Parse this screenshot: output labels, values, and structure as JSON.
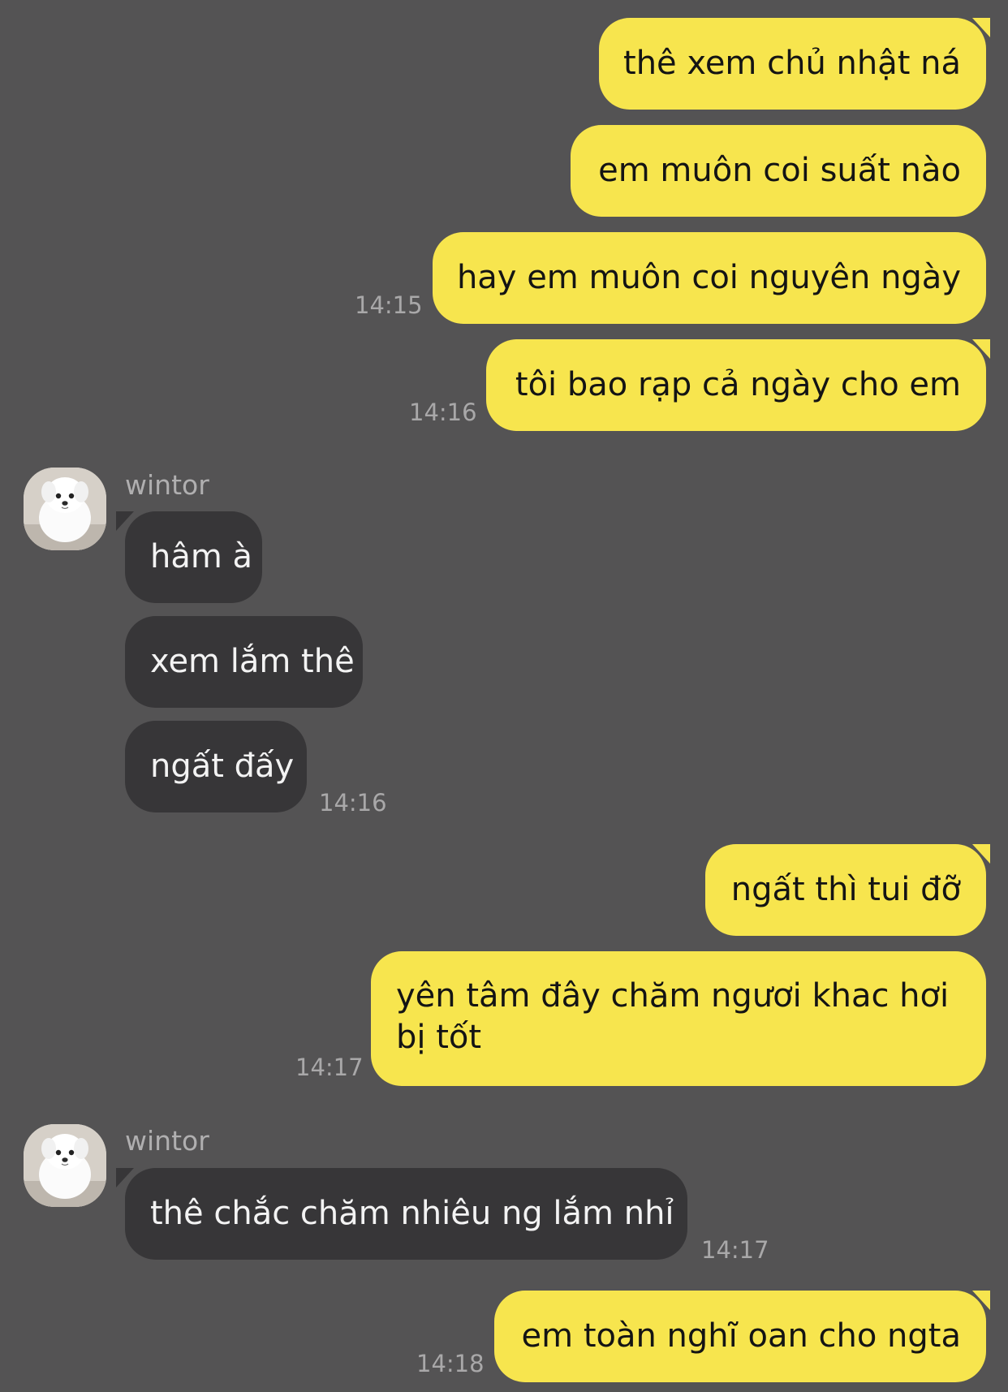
{
  "theme": {
    "background": "#545354",
    "sent_bubble": "#f7e54e",
    "received_bubble": "#373638",
    "timestamp_color": "#a9a8a9"
  },
  "avatar_icon": "white-dog-photo",
  "messages": [
    {
      "dir": "sent",
      "text": "thê xem chủ nhật ná"
    },
    {
      "dir": "sent",
      "text": "em muôn coi suất nào"
    },
    {
      "dir": "sent",
      "text": "hay em muôn coi nguyên ngày",
      "time": "14:15"
    },
    {
      "dir": "sent",
      "text": "tôi bao rạp cả ngày cho em",
      "time": "14:16"
    },
    {
      "dir": "received",
      "sender": "wintor",
      "text": "hâm à"
    },
    {
      "dir": "received",
      "text": "xem lắm thê"
    },
    {
      "dir": "received",
      "text": "ngất đấy",
      "time": "14:16"
    },
    {
      "dir": "sent",
      "text": "ngất thì tui đỡ"
    },
    {
      "dir": "sent",
      "text": "yên tâm đây chăm ngươi khac hơi bị tốt",
      "time": "14:17"
    },
    {
      "dir": "received",
      "sender": "wintor",
      "text": "thê chắc chăm nhiêu ng lắm nhỉ",
      "time": "14:17"
    },
    {
      "dir": "sent",
      "text": "em toàn nghĩ oan cho ngta",
      "time": "14:18"
    }
  ]
}
